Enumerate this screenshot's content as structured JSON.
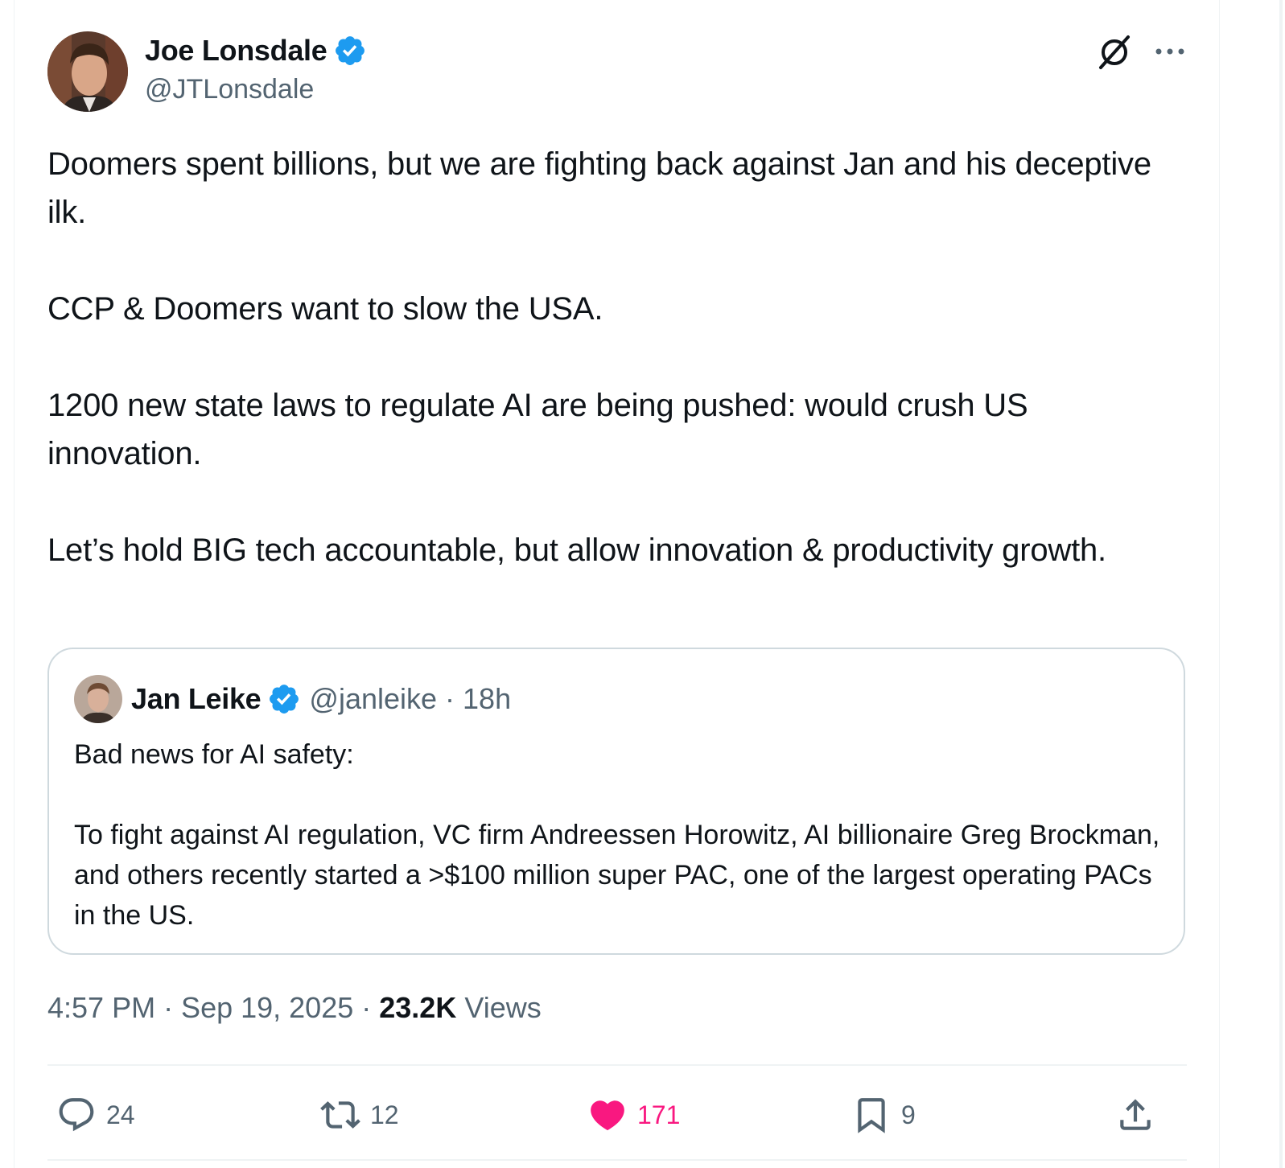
{
  "author": {
    "name": "Joe Lonsdale",
    "handle": "@JTLonsdale",
    "verified": true
  },
  "header_icons": [
    "grok-icon",
    "more-icon"
  ],
  "tweet": {
    "paragraphs": [
      "Doomers spent billions, but we are fighting back against Jan and his deceptive ilk.",
      "CCP & Doomers want to slow the USA.",
      "1200 new state laws to regulate AI are being pushed: would crush US innovation.",
      "Let’s hold BIG tech accountable, but allow innovation & productivity growth."
    ]
  },
  "quote": {
    "name": "Jan Leike",
    "meta": "@janleike · 18h",
    "verified": true,
    "paragraphs": [
      "Bad news for AI safety:",
      "To fight against AI regulation, VC firm Andreessen Horowitz, AI billionaire Greg Brockman, and others recently started a >$100 million super PAC, one of the largest operating PACs in the US."
    ]
  },
  "timestamp": {
    "time_date": "4:57 PM · Sep 19, 2025 · ",
    "views_count": "23.2K",
    "views_label": " Views"
  },
  "actions": {
    "replies": "24",
    "reposts": "12",
    "likes": "171",
    "bookmarks": "9"
  },
  "colors": {
    "text": "#0f1419",
    "secondary": "#536471",
    "verified": "#1d9bf0",
    "like": "#f91880",
    "border": "#cfd9de"
  }
}
